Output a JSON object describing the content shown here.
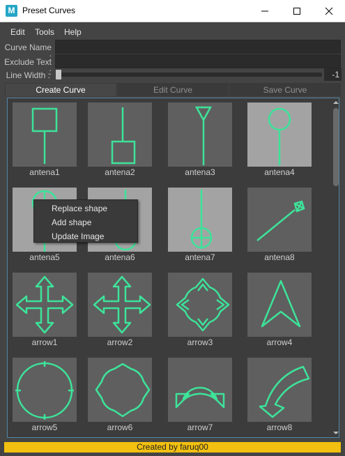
{
  "window": {
    "title": "Preset Curves",
    "app_icon_letter": "M",
    "minimize_icon": "minimize-icon",
    "maximize_icon": "maximize-icon",
    "close_icon": "close-icon"
  },
  "menu": {
    "edit": "Edit",
    "tools": "Tools",
    "help": "Help"
  },
  "fields": {
    "curve_name_label": "Curve Name :",
    "curve_name_value": "",
    "exclude_text_label": "Exclude Text :",
    "exclude_text_value": "",
    "line_width_label": "Line Width :",
    "line_width_value": "-1",
    "line_width_position": 0
  },
  "tabs": {
    "create": "Create Curve",
    "edit": "Edit Curve",
    "save": "Save Curve",
    "active": "Create Curve"
  },
  "grid": {
    "curve_color": "#3de39a",
    "items": [
      {
        "label": "antena1",
        "icon": "antena1-shape-icon",
        "highlight": false
      },
      {
        "label": "antena2",
        "icon": "antena2-shape-icon",
        "highlight": false
      },
      {
        "label": "antena3",
        "icon": "antena3-shape-icon",
        "highlight": false
      },
      {
        "label": "antena4",
        "icon": "antena4-shape-icon",
        "highlight": true
      },
      {
        "label": "antena5",
        "icon": "antena5-shape-icon",
        "highlight": true
      },
      {
        "label": "antena6",
        "icon": "antena6-shape-icon",
        "highlight": true
      },
      {
        "label": "antena7",
        "icon": "antena7-shape-icon",
        "highlight": true
      },
      {
        "label": "antena8",
        "icon": "antena8-shape-icon",
        "highlight": false
      },
      {
        "label": "arrow1",
        "icon": "arrow1-shape-icon",
        "highlight": false
      },
      {
        "label": "arrow2",
        "icon": "arrow2-shape-icon",
        "highlight": false
      },
      {
        "label": "arrow3",
        "icon": "arrow3-shape-icon",
        "highlight": false
      },
      {
        "label": "arrow4",
        "icon": "arrow4-shape-icon",
        "highlight": false
      },
      {
        "label": "arrow5",
        "icon": "arrow5-shape-icon",
        "highlight": false
      },
      {
        "label": "arrow6",
        "icon": "arrow6-shape-icon",
        "highlight": false
      },
      {
        "label": "arrow7",
        "icon": "arrow7-shape-icon",
        "highlight": false
      },
      {
        "label": "arrow8",
        "icon": "arrow8-shape-icon",
        "highlight": false
      }
    ]
  },
  "context_menu": {
    "replace": "Replace shape",
    "add": "Add shape",
    "update_image": "Update Image"
  },
  "footer": {
    "text": "Created by faruq00",
    "color": "#f2c010"
  }
}
